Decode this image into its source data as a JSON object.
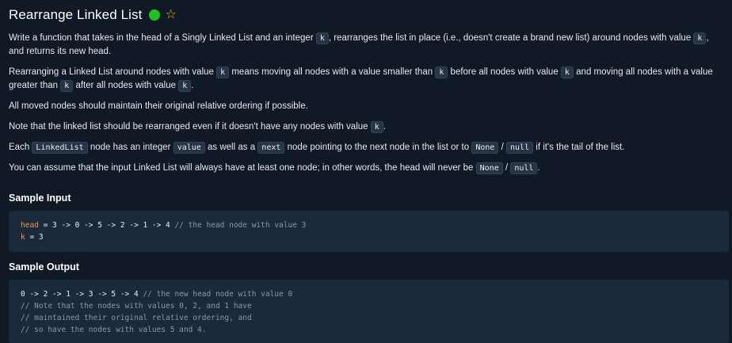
{
  "title": "Rearrange Linked List",
  "status_color": "#1ec31e",
  "star_color": "#f5b800",
  "p1": {
    "a": "Write a function that takes in the head of a Singly Linked List and an integer ",
    "k1": "k",
    "b": ", rearranges the list in place (i.e., doesn't create a brand new list) around nodes with value ",
    "k2": "k",
    "c": ", and returns its new head."
  },
  "p2": {
    "a": "Rearranging a Linked List around nodes with value ",
    "k1": "k",
    "b": " means moving all nodes with a value smaller than ",
    "k2": "k",
    "c": " before all nodes with value ",
    "k3": "k",
    "d": " and moving all nodes with a value greater than ",
    "k4": "k",
    "e": " after all nodes with value ",
    "k5": "k",
    "f": "."
  },
  "p3": "All moved nodes should maintain their original relative ordering if possible.",
  "p4": {
    "a": "Note that the linked list should be rearranged even if it doesn't have any nodes with value ",
    "k1": "k",
    "b": "."
  },
  "p5": {
    "a": "Each ",
    "c1": "LinkedList",
    "b": " node has an integer ",
    "c2": "value",
    "c": " as well as a ",
    "c3": "next",
    "d": " node pointing to the next node in the list or to ",
    "c4": "None",
    "e": " / ",
    "c5": "null",
    "f": " if it's the tail of the list."
  },
  "p6": {
    "a": "You can assume that the input Linked List will always have at least one node; in other words, the head will never be ",
    "c1": "None",
    "b": " / ",
    "c2": "null",
    "c": "."
  },
  "sample_input": {
    "heading": "Sample Input",
    "line1_var": "head",
    "line1_val": " = 3 -> 0 -> 5 -> 2 -> 1 -> 4 ",
    "line1_comment": "// the head node with value 3",
    "line2_var": "k",
    "line2_val": " = 3"
  },
  "sample_output": {
    "heading": "Sample Output",
    "line1_val": "0 -> 2 -> 1 -> 3 -> 5 -> 4 ",
    "line1_comment": "// the new head node with value 0",
    "line2": "// Note that the nodes with values 0, 2, and 1 have",
    "line3": "// maintained their original relative ordering, and",
    "line4": "// so have the nodes with values 5 and 4."
  }
}
